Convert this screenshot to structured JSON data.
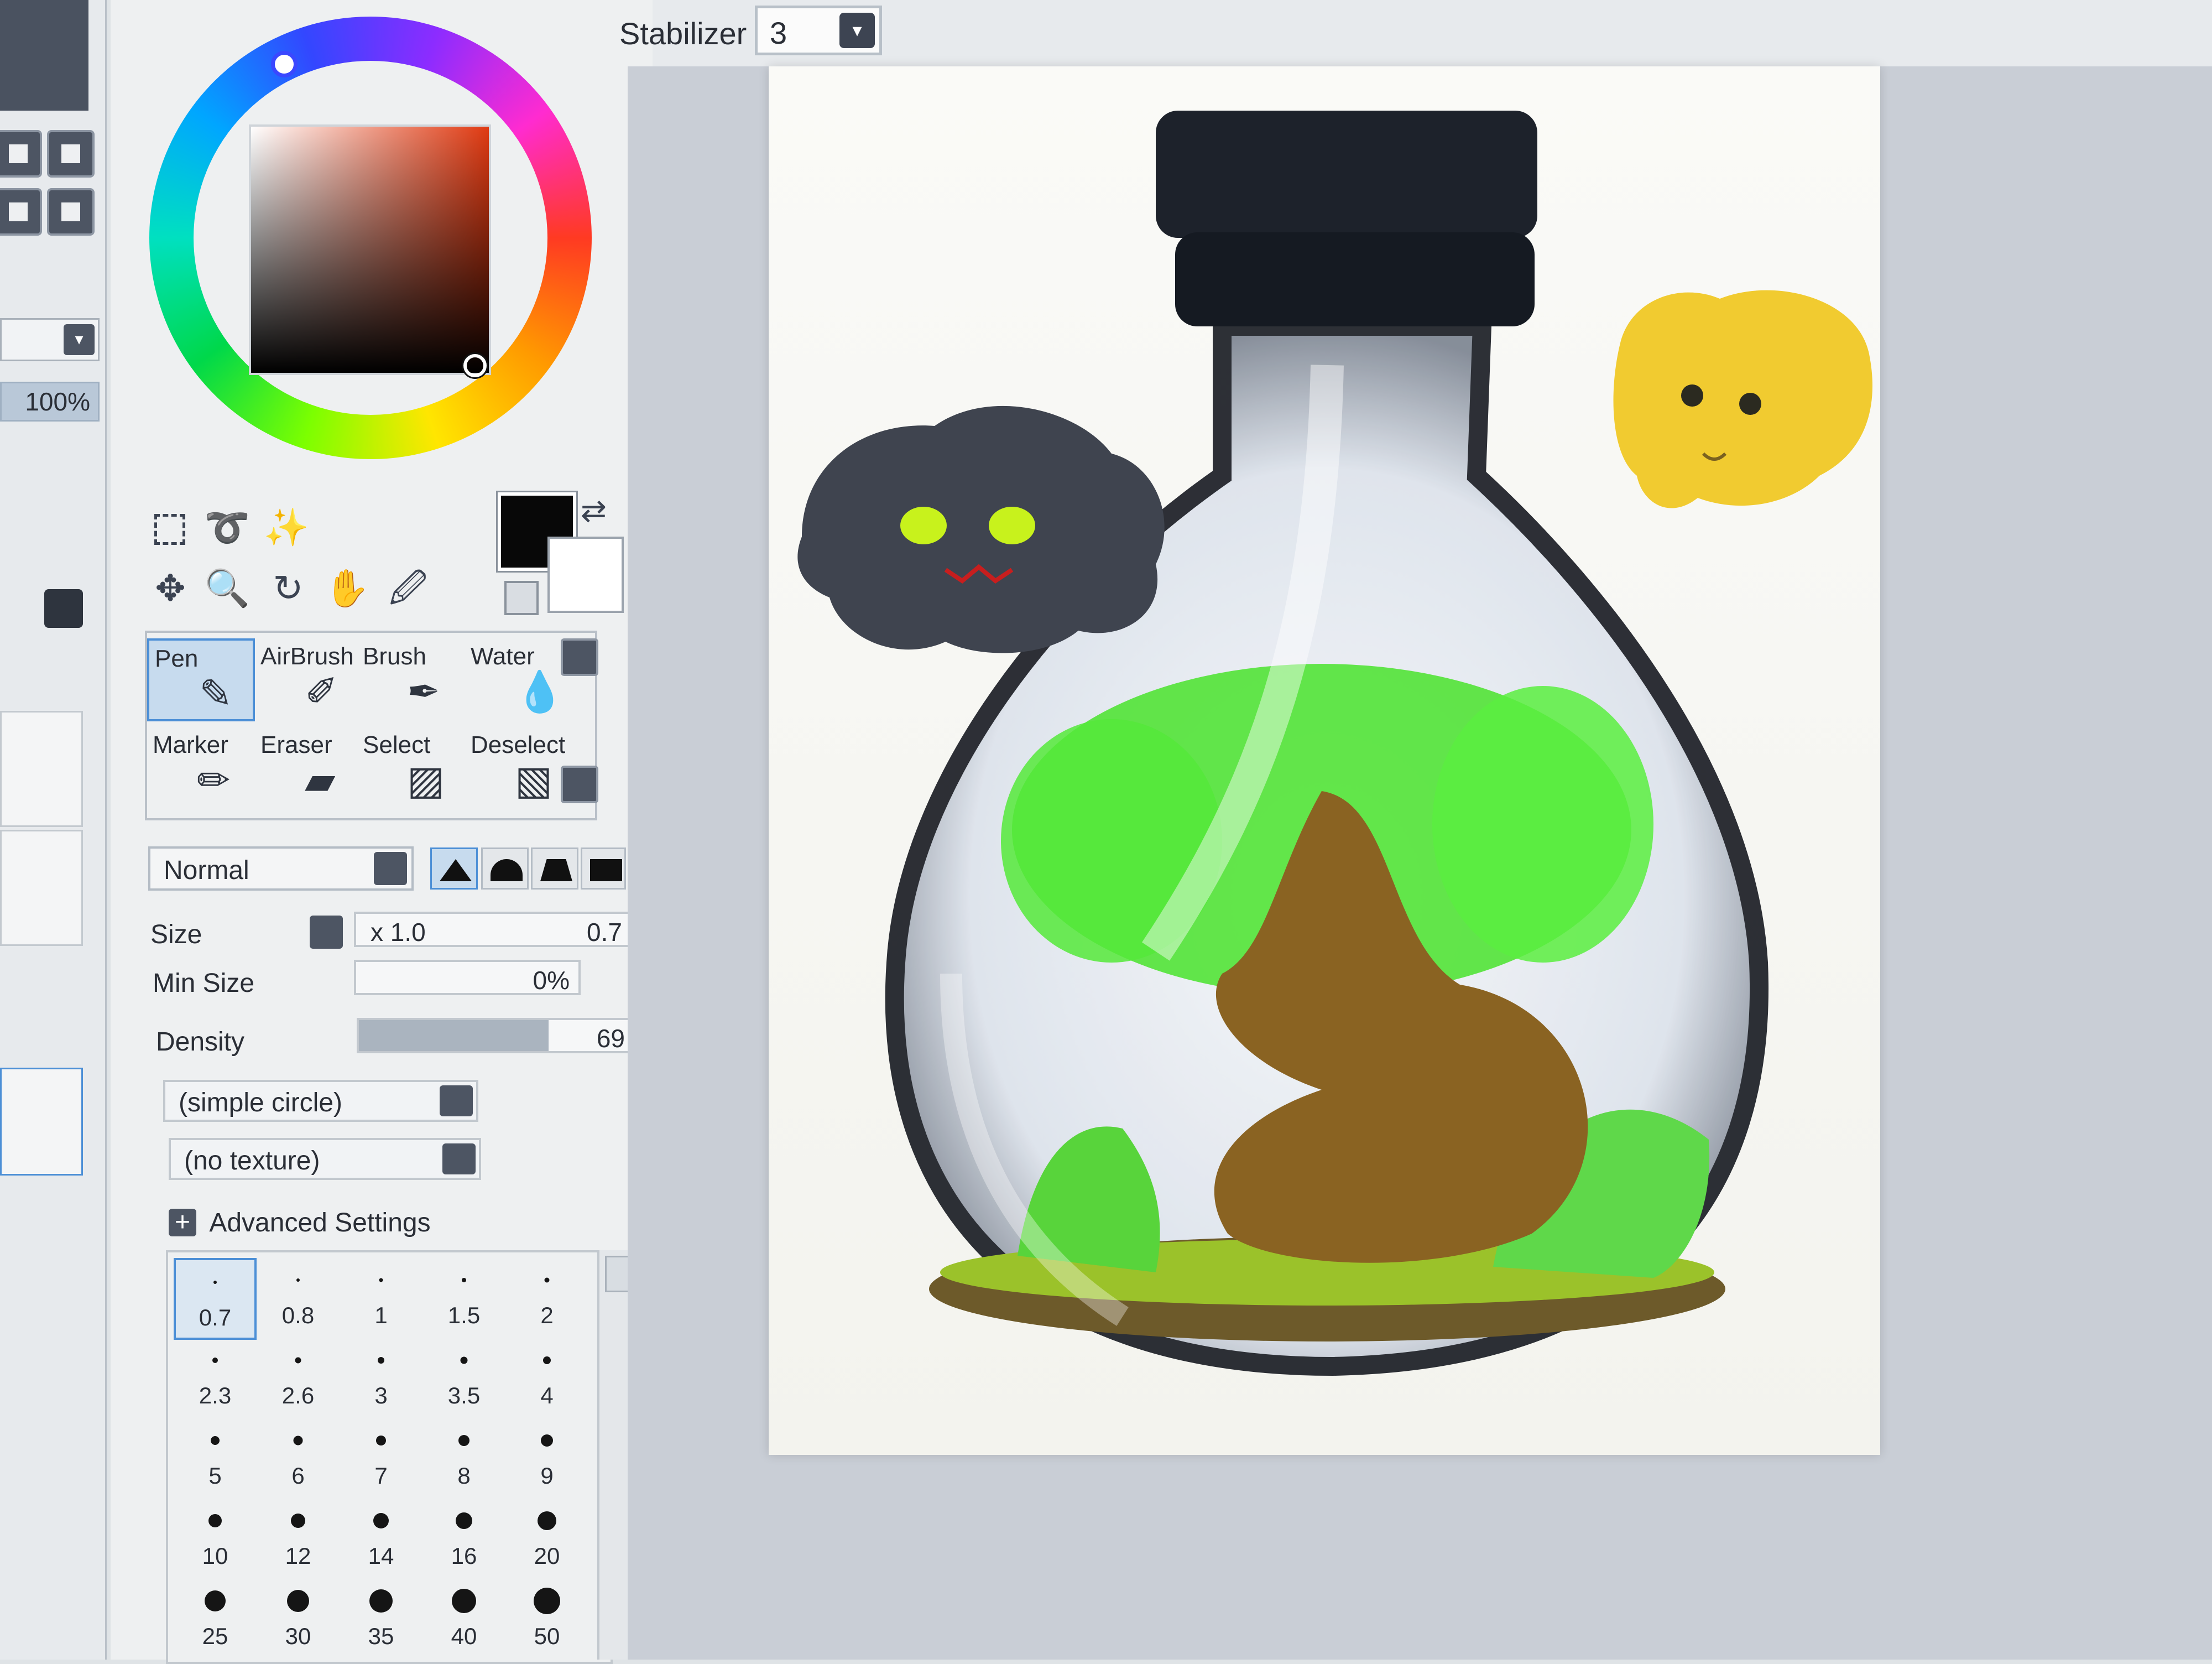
{
  "left_panel": {
    "zoom_value": "100%"
  },
  "toolbar": {
    "stabilizer_label": "Stabilizer",
    "stabilizer_value": "3"
  },
  "color": {
    "foreground": "#080808",
    "background": "#ffffff"
  },
  "selection_tools": [
    "marquee-icon",
    "lasso-icon",
    "magic-wand-icon"
  ],
  "nav_tools": [
    "move-icon",
    "zoom-icon",
    "rotate-icon",
    "hand-icon",
    "eyedropper-icon"
  ],
  "brushes": [
    {
      "label": "Pen",
      "selected": true
    },
    {
      "label": "AirBrush"
    },
    {
      "label": "Brush"
    },
    {
      "label": "Water"
    },
    {
      "label": "Marker"
    },
    {
      "label": "Eraser"
    },
    {
      "label": "Select"
    },
    {
      "label": "Deselect"
    }
  ],
  "brush_settings": {
    "blend_mode": "Normal",
    "size_label": "Size",
    "size_multiplier": "x 1.0",
    "size_value": "0.7",
    "min_size_label": "Min Size",
    "min_size_value": "0%",
    "density_label": "Density",
    "density_value": "69",
    "density_fraction": 0.69,
    "shape_dropdown": "(simple circle)",
    "texture_dropdown": "(no texture)",
    "advanced_label": "Advanced Settings"
  },
  "size_presets": [
    "0.7",
    "0.8",
    "1",
    "1.5",
    "2",
    "2.3",
    "2.6",
    "3",
    "3.5",
    "4",
    "5",
    "6",
    "7",
    "8",
    "9",
    "10",
    "12",
    "14",
    "16",
    "20",
    "25",
    "30",
    "35",
    "40",
    "50"
  ],
  "size_preset_selected": "0.7"
}
